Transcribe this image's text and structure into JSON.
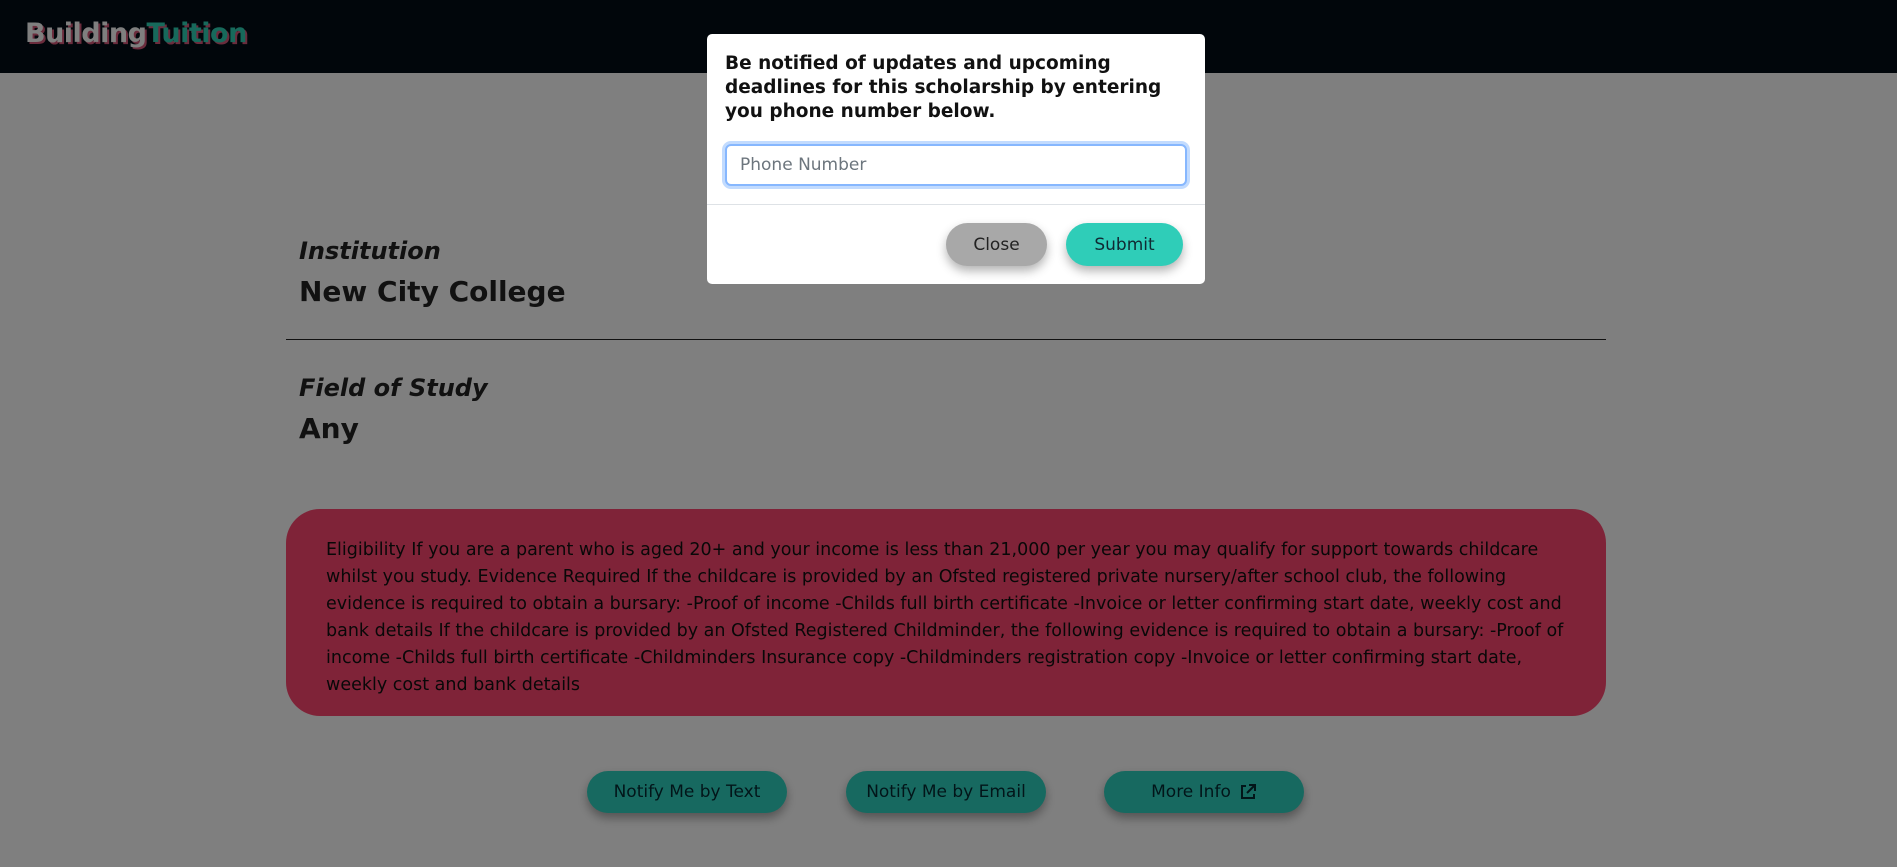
{
  "navbar": {
    "brand_part1": "Building",
    "brand_part2": "Tuition"
  },
  "details": {
    "institution_label": "Institution",
    "institution_value": "New City College",
    "field_label": "Field of Study",
    "field_value": "Any"
  },
  "eligibility": {
    "text": "Eligibility If you are a parent who is aged 20+ and your income is less than 21,000 per year you may qualify for support towards childcare whilst you study. Evidence Required If the childcare is provided by an Ofsted registered private nursery/after school club, the following evidence is required to obtain a bursary: -Proof of income -Childs full birth certificate -Invoice or letter confirming start date, weekly cost and bank details If the childcare is provided by an Ofsted Registered Childminder, the following evidence is required to obtain a bursary: -Proof of income -Childs full birth certificate -Childminders Insurance copy -Childminders registration copy -Invoice or letter confirming start date, weekly cost and bank details"
  },
  "actions": {
    "notify_text": "Notify Me by Text",
    "notify_email": "Notify Me by Email",
    "more_info": "More Info",
    "more_info_icon": "external-link-icon"
  },
  "modal": {
    "message": "Be notified of updates and upcoming deadlines for this scholarship by entering you phone number below.",
    "phone_placeholder": "Phone Number",
    "phone_value": "",
    "close_label": "Close",
    "submit_label": "Submit"
  },
  "colors": {
    "navbar_bg": "#020d17",
    "brand_accent": "#2fd3b7",
    "eligibility_bg": "#ff4770",
    "action_button": "#2fd3c0",
    "close_button": "#a8a8a8",
    "overlay": "rgba(0,0,0,0.5)"
  }
}
